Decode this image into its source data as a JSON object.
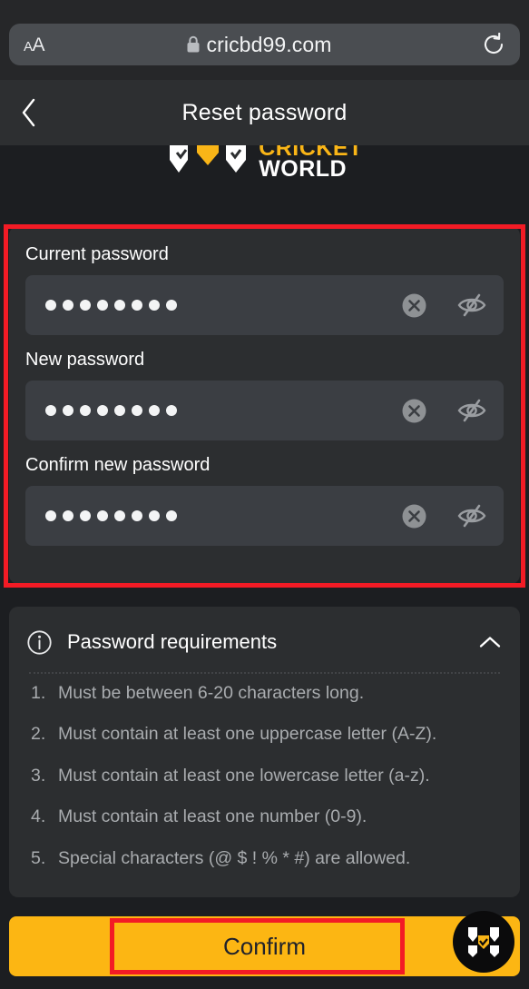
{
  "browser": {
    "text_size_small": "A",
    "text_size_large": "A",
    "url": "cricbd99.com",
    "lock_icon": "lock-icon",
    "reload_icon": "reload-icon"
  },
  "header": {
    "back_icon": "chevron-left-icon",
    "title": "Reset password"
  },
  "logo": {
    "line1": "CRICKET",
    "line2": "WORLD"
  },
  "form": {
    "fields": [
      {
        "label": "Current password",
        "value": "••••••••",
        "dot_count": 8,
        "clear_icon": "clear-circle-icon",
        "visibility_icon": "eye-off-icon"
      },
      {
        "label": "New password",
        "value": "••••••••",
        "dot_count": 8,
        "clear_icon": "clear-circle-icon",
        "visibility_icon": "eye-off-icon"
      },
      {
        "label": "Confirm new password",
        "value": "••••••••",
        "dot_count": 8,
        "clear_icon": "clear-circle-icon",
        "visibility_icon": "eye-off-icon"
      }
    ]
  },
  "requirements": {
    "info_icon": "info-circle-icon",
    "title": "Password requirements",
    "collapse_icon": "chevron-up-icon",
    "items": [
      {
        "num": "1.",
        "text": "Must be between 6-20 characters long."
      },
      {
        "num": "2.",
        "text": "Must contain at least one uppercase letter (A-Z)."
      },
      {
        "num": "3.",
        "text": "Must contain at least one lowercase letter (a-z)."
      },
      {
        "num": "4.",
        "text": "Must contain at least one number (0-9)."
      },
      {
        "num": "5.",
        "text": "Special characters (@ $ ! % * #) are allowed."
      }
    ]
  },
  "footer": {
    "confirm_label": "Confirm",
    "fab_icon": "cricket-world-logo-icon"
  },
  "colors": {
    "accent_yellow": "#fcb613",
    "logo_gold": "#f9b517",
    "page_background": "#1c1e21",
    "card_background": "#2c2e30",
    "input_background": "#3b3e43",
    "annotation_red": "#f31b25",
    "requirement_text": "#a9acaf"
  }
}
